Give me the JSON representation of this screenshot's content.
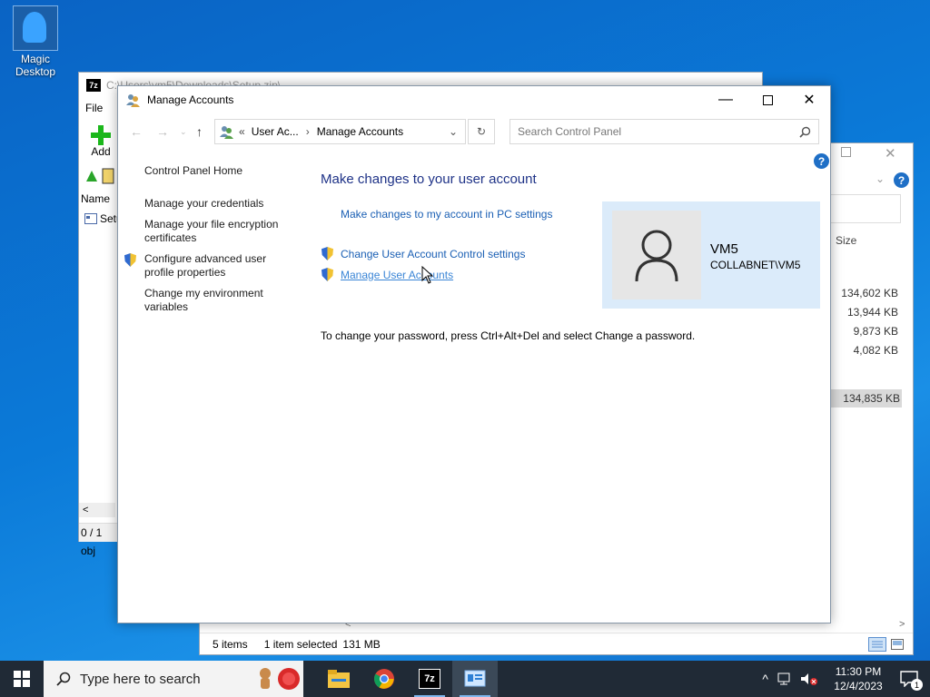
{
  "desktop": {
    "icon_label": "Magic Desktop"
  },
  "zip_window": {
    "title": "C:\\Users\\vm5\\Downloads\\Setup.zip\\",
    "menu": [
      "File",
      "E"
    ],
    "add_label": "Add",
    "col_name": "Name",
    "row_name": "Setu",
    "status": "0 / 1 obj"
  },
  "explorer_window": {
    "col_size": "Size",
    "sizes": [
      "134,602 KB",
      "13,944 KB",
      "9,873 KB",
      "4,082 KB"
    ],
    "selected_size": "134,835 KB",
    "status_items": "5 items",
    "status_selected": "1 item selected",
    "status_size": "131 MB"
  },
  "manage_window": {
    "title": "Manage Accounts",
    "breadcrumb_prefix": "«",
    "breadcrumb_1": "User Ac...",
    "breadcrumb_2": "Manage Accounts",
    "search_placeholder": "Search Control Panel",
    "left_nav": {
      "home": "Control Panel Home",
      "credentials": "Manage your credentials",
      "encryption": "Manage your file encryption certificates",
      "advanced_profile": "Configure advanced user profile properties",
      "environment": "Change my environment variables"
    },
    "heading": "Make changes to your user account",
    "link_pc_settings": "Make changes to my account in PC settings",
    "link_uac": "Change User Account Control settings",
    "link_manage_users": "Manage User Accounts",
    "user_name": "VM5",
    "user_domain": "COLLABNET\\VM5",
    "password_note": "To change your password, press Ctrl+Alt+Del and select Change a password."
  },
  "taskbar": {
    "search_placeholder": "Type here to search",
    "time": "11:30 PM",
    "date": "12/4/2023",
    "notification_count": "1"
  },
  "colors": {
    "accent": "#1a5fb4",
    "heading": "#1e3287",
    "user_panel": "#dbebfa",
    "taskbar": "#202a36"
  }
}
